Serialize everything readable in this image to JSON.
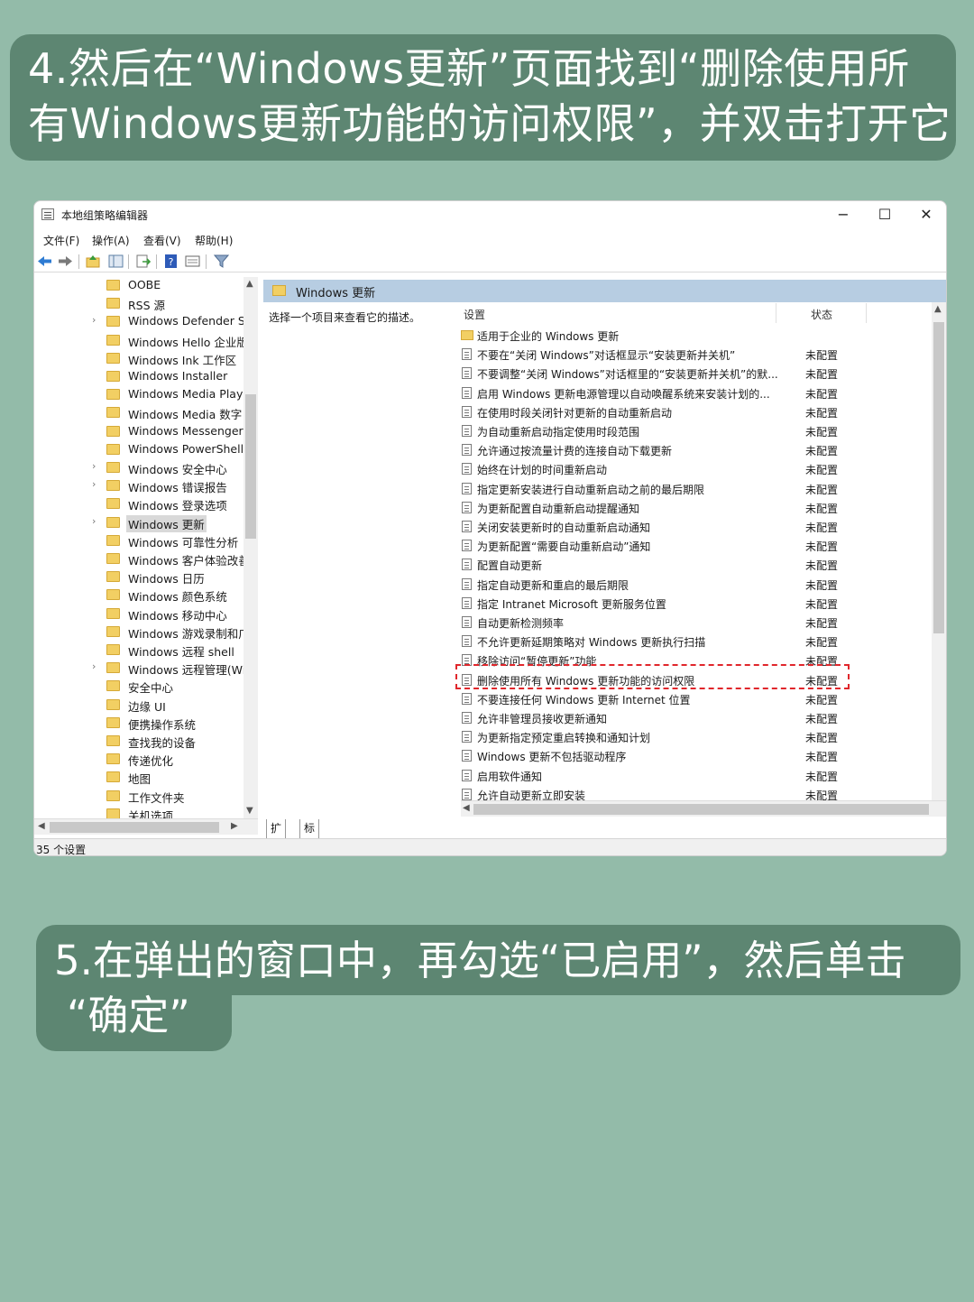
{
  "step4": {
    "line1": "4.然后在“Windows更新”页面找到“删除使用所",
    "line2": "有Windows更新功能的访问权限”，并双击打开它"
  },
  "step5": {
    "line1": "5.在弹出的窗口中，再勾选“已启用”，然后单击",
    "line2": "“确定”"
  },
  "window": {
    "title": "本地组策略编辑器",
    "menu": [
      "文件(F)",
      "操作(A)",
      "查看(V)",
      "帮助(H)"
    ],
    "tree": [
      {
        "label": "OOBE",
        "expand": false
      },
      {
        "label": "RSS 源",
        "expand": false
      },
      {
        "label": "Windows Defender Sr",
        "expand": true
      },
      {
        "label": "Windows Hello 企业版",
        "expand": false
      },
      {
        "label": "Windows Ink 工作区",
        "expand": false
      },
      {
        "label": "Windows Installer",
        "expand": false
      },
      {
        "label": "Windows Media Playe",
        "expand": false
      },
      {
        "label": "Windows Media 数字",
        "expand": false
      },
      {
        "label": "Windows Messenger",
        "expand": false
      },
      {
        "label": "Windows PowerShell",
        "expand": false
      },
      {
        "label": "Windows 安全中心",
        "expand": true
      },
      {
        "label": "Windows 错误报告",
        "expand": true
      },
      {
        "label": "Windows 登录选项",
        "expand": false
      },
      {
        "label": "Windows 更新",
        "expand": true,
        "selected": true
      },
      {
        "label": "Windows 可靠性分析",
        "expand": false
      },
      {
        "label": "Windows 客户体验改善",
        "expand": false
      },
      {
        "label": "Windows 日历",
        "expand": false
      },
      {
        "label": "Windows 颜色系统",
        "expand": false
      },
      {
        "label": "Windows 移动中心",
        "expand": false
      },
      {
        "label": "Windows 游戏录制和广",
        "expand": false
      },
      {
        "label": "Windows 远程 shell",
        "expand": false
      },
      {
        "label": "Windows 远程管理(Wi",
        "expand": true
      },
      {
        "label": "安全中心",
        "expand": false
      },
      {
        "label": "边缘 UI",
        "expand": false
      },
      {
        "label": "便携操作系统",
        "expand": false
      },
      {
        "label": "查找我的设备",
        "expand": false
      },
      {
        "label": "传递优化",
        "expand": false
      },
      {
        "label": "地图",
        "expand": false
      },
      {
        "label": "工作文件夹",
        "expand": false
      },
      {
        "label": "关机选项",
        "expand": false
      }
    ],
    "pane_title": "Windows 更新",
    "description": "选择一个项目来查看它的描述。",
    "col_setting": "设置",
    "col_state": "状态",
    "rows": [
      {
        "name": "适用于企业的 Windows 更新",
        "state": "",
        "folder": true
      },
      {
        "name": "不要在“关闭 Windows”对话框显示“安装更新并关机”",
        "state": "未配置"
      },
      {
        "name": "不要调整“关闭 Windows”对话框里的“安装更新并关机”的默...",
        "state": "未配置"
      },
      {
        "name": "启用 Windows 更新电源管理以自动唤醒系统来安装计划的...",
        "state": "未配置"
      },
      {
        "name": "在使用时段关闭针对更新的自动重新启动",
        "state": "未配置"
      },
      {
        "name": "为自动重新启动指定使用时段范围",
        "state": "未配置"
      },
      {
        "name": "允许通过按流量计费的连接自动下载更新",
        "state": "未配置"
      },
      {
        "name": "始终在计划的时间重新启动",
        "state": "未配置"
      },
      {
        "name": "指定更新安装进行自动重新启动之前的最后期限",
        "state": "未配置"
      },
      {
        "name": "为更新配置自动重新启动提醒通知",
        "state": "未配置"
      },
      {
        "name": "关闭安装更新时的自动重新启动通知",
        "state": "未配置"
      },
      {
        "name": "为更新配置“需要自动重新启动”通知",
        "state": "未配置"
      },
      {
        "name": "配置自动更新",
        "state": "未配置"
      },
      {
        "name": "指定自动更新和重启的最后期限",
        "state": "未配置"
      },
      {
        "name": "指定 Intranet Microsoft 更新服务位置",
        "state": "未配置"
      },
      {
        "name": "自动更新检测频率",
        "state": "未配置"
      },
      {
        "name": "不允许更新延期策略对 Windows 更新执行扫描",
        "state": "未配置"
      },
      {
        "name": "移除访问“暂停更新”功能",
        "state": "未配置"
      },
      {
        "name": "删除使用所有 Windows 更新功能的访问权限",
        "state": "未配置"
      },
      {
        "name": "不要连接任何 Windows 更新 Internet 位置",
        "state": "未配置"
      },
      {
        "name": "允许非管理员接收更新通知",
        "state": "未配置"
      },
      {
        "name": "为更新指定预定重启转换和通知计划",
        "state": "未配置"
      },
      {
        "name": "Windows 更新不包括驱动程序",
        "state": "未配置"
      },
      {
        "name": "启用软件通知",
        "state": "未配置"
      },
      {
        "name": "允许自动更新立即安装",
        "state": "未配置"
      }
    ],
    "tabs": [
      "扩展",
      "标准"
    ],
    "status": "35 个设置",
    "highlight_color": "#e0262b"
  }
}
